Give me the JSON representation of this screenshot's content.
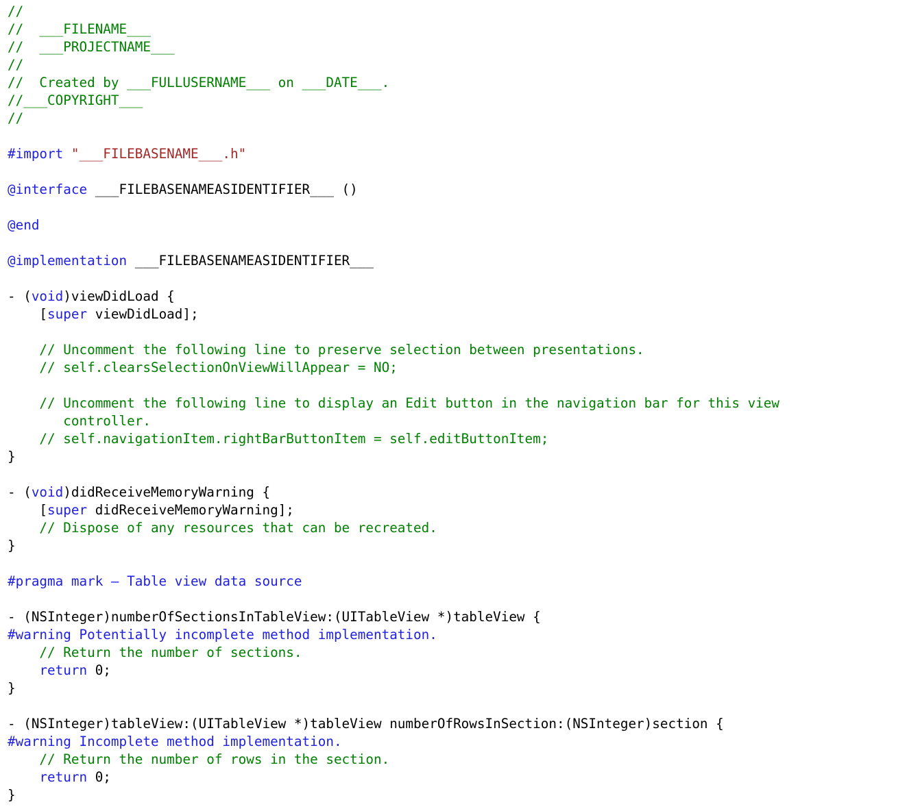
{
  "editor": {
    "language": "Objective-C",
    "background_color": "#ffffff",
    "colors": {
      "comment": "#008000",
      "keyword": "#2020e0",
      "directive": "#2020e0",
      "string": "#a32727",
      "plain": "#000000"
    }
  },
  "code": {
    "lines": [
      {
        "tokens": [
          {
            "t": "//",
            "c": "comment"
          }
        ]
      },
      {
        "tokens": [
          {
            "t": "//  ___FILENAME___",
            "c": "comment"
          }
        ]
      },
      {
        "tokens": [
          {
            "t": "//  ___PROJECTNAME___",
            "c": "comment"
          }
        ]
      },
      {
        "tokens": [
          {
            "t": "//",
            "c": "comment"
          }
        ]
      },
      {
        "tokens": [
          {
            "t": "//  Created by ___FULLUSERNAME___ on ___DATE___.",
            "c": "comment"
          }
        ]
      },
      {
        "tokens": [
          {
            "t": "//___COPYRIGHT___",
            "c": "comment"
          }
        ]
      },
      {
        "tokens": [
          {
            "t": "//",
            "c": "comment"
          }
        ]
      },
      {
        "tokens": []
      },
      {
        "tokens": [
          {
            "t": "#import ",
            "c": "directive"
          },
          {
            "t": "\"___FILEBASENAME___.h\"",
            "c": "string"
          }
        ]
      },
      {
        "tokens": []
      },
      {
        "tokens": [
          {
            "t": "@interface",
            "c": "keyword"
          },
          {
            "t": " ___FILEBASENAMEASIDENTIFIER___ ()",
            "c": "plain"
          }
        ]
      },
      {
        "tokens": []
      },
      {
        "tokens": [
          {
            "t": "@end",
            "c": "keyword"
          }
        ]
      },
      {
        "tokens": []
      },
      {
        "tokens": [
          {
            "t": "@implementation",
            "c": "keyword"
          },
          {
            "t": " ___FILEBASENAMEASIDENTIFIER___",
            "c": "plain"
          }
        ]
      },
      {
        "tokens": []
      },
      {
        "tokens": [
          {
            "t": "- (",
            "c": "plain"
          },
          {
            "t": "void",
            "c": "keyword"
          },
          {
            "t": ")viewDidLoad {",
            "c": "plain"
          }
        ]
      },
      {
        "tokens": [
          {
            "t": "    [",
            "c": "plain"
          },
          {
            "t": "super",
            "c": "keyword"
          },
          {
            "t": " viewDidLoad];",
            "c": "plain"
          }
        ]
      },
      {
        "tokens": []
      },
      {
        "tokens": [
          {
            "t": "    // Uncomment the following line to preserve selection between presentations.",
            "c": "comment"
          }
        ]
      },
      {
        "tokens": [
          {
            "t": "    // self.clearsSelectionOnViewWillAppear = NO;",
            "c": "comment"
          }
        ]
      },
      {
        "tokens": []
      },
      {
        "tokens": [
          {
            "t": "    // Uncomment the following line to display an Edit button in the navigation bar for this view",
            "c": "comment"
          }
        ]
      },
      {
        "tokens": [
          {
            "t": "       controller.",
            "c": "comment"
          }
        ]
      },
      {
        "tokens": [
          {
            "t": "    // self.navigationItem.rightBarButtonItem = self.editButtonItem;",
            "c": "comment"
          }
        ]
      },
      {
        "tokens": [
          {
            "t": "}",
            "c": "plain"
          }
        ]
      },
      {
        "tokens": []
      },
      {
        "tokens": [
          {
            "t": "- (",
            "c": "plain"
          },
          {
            "t": "void",
            "c": "keyword"
          },
          {
            "t": ")didReceiveMemoryWarning {",
            "c": "plain"
          }
        ]
      },
      {
        "tokens": [
          {
            "t": "    [",
            "c": "plain"
          },
          {
            "t": "super",
            "c": "keyword"
          },
          {
            "t": " didReceiveMemoryWarning];",
            "c": "plain"
          }
        ]
      },
      {
        "tokens": [
          {
            "t": "    // Dispose of any resources that can be recreated.",
            "c": "comment"
          }
        ]
      },
      {
        "tokens": [
          {
            "t": "}",
            "c": "plain"
          }
        ]
      },
      {
        "tokens": []
      },
      {
        "tokens": [
          {
            "t": "#pragma mark – Table view data source",
            "c": "directive"
          }
        ]
      },
      {
        "tokens": []
      },
      {
        "tokens": [
          {
            "t": "- (NSInteger)numberOfSectionsInTableView:(UITableView *)tableView {",
            "c": "plain"
          }
        ]
      },
      {
        "tokens": [
          {
            "t": "#warning Potentially incomplete method implementation.",
            "c": "directive"
          }
        ]
      },
      {
        "tokens": [
          {
            "t": "    // Return the number of sections.",
            "c": "comment"
          }
        ]
      },
      {
        "tokens": [
          {
            "t": "    ",
            "c": "plain"
          },
          {
            "t": "return",
            "c": "keyword"
          },
          {
            "t": " 0;",
            "c": "plain"
          }
        ]
      },
      {
        "tokens": [
          {
            "t": "}",
            "c": "plain"
          }
        ]
      },
      {
        "tokens": []
      },
      {
        "tokens": [
          {
            "t": "- (NSInteger)tableView:(UITableView *)tableView numberOfRowsInSection:(NSInteger)section {",
            "c": "plain"
          }
        ]
      },
      {
        "tokens": [
          {
            "t": "#warning Incomplete method implementation.",
            "c": "directive"
          }
        ]
      },
      {
        "tokens": [
          {
            "t": "    // Return the number of rows in the section.",
            "c": "comment"
          }
        ]
      },
      {
        "tokens": [
          {
            "t": "    ",
            "c": "plain"
          },
          {
            "t": "return",
            "c": "keyword"
          },
          {
            "t": " 0;",
            "c": "plain"
          }
        ]
      },
      {
        "tokens": [
          {
            "t": "}",
            "c": "plain"
          }
        ]
      }
    ]
  }
}
